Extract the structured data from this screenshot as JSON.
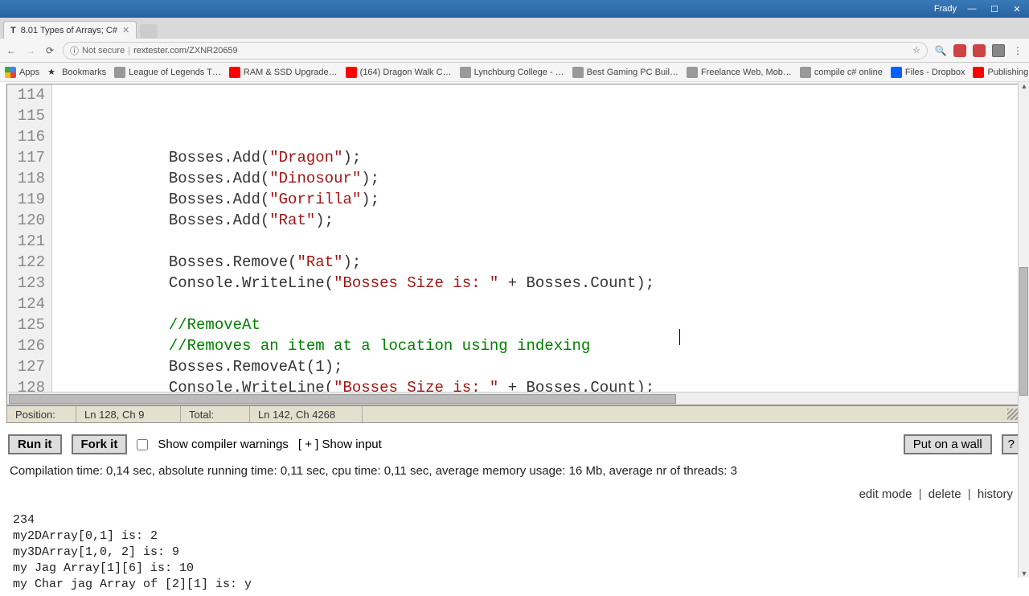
{
  "titlebar": {
    "username": "Frady",
    "min": "—",
    "max": "☐",
    "close": "✕"
  },
  "tab": {
    "favicon": "T",
    "title": "8.01 Types of Arrays; C#",
    "close": "✕"
  },
  "addr": {
    "back": "←",
    "fwd": "→",
    "reload": "⟳",
    "secure_icon": "ⓘ",
    "secure_text": "Not secure",
    "url": "rextester.com/ZXNR20659",
    "star": "☆",
    "menu": "⋮"
  },
  "bookmarks": [
    {
      "icon": "apps",
      "label": "Apps"
    },
    {
      "icon": "star",
      "label": "Bookmarks"
    },
    {
      "icon": "generic",
      "label": "League of Legends T…"
    },
    {
      "icon": "yt",
      "label": "RAM & SSD Upgrade…"
    },
    {
      "icon": "yt",
      "label": "(164) Dragon Walk C…"
    },
    {
      "icon": "generic",
      "label": "Lynchburg College - …"
    },
    {
      "icon": "generic",
      "label": "Best Gaming PC Buil…"
    },
    {
      "icon": "generic",
      "label": "Freelance Web, Mob…"
    },
    {
      "icon": "generic",
      "label": "compile c# online"
    },
    {
      "icon": "db",
      "label": "Files - Dropbox"
    },
    {
      "icon": "yt",
      "label": "Publishing to Google…"
    }
  ],
  "code": {
    "first_line": 114,
    "lines": [
      {
        "pre": "            Bosses.Add(",
        "str": "\"Dragon\"",
        "post": ");"
      },
      {
        "pre": "            Bosses.Add(",
        "str": "\"Dinosour\"",
        "post": ");"
      },
      {
        "pre": "            Bosses.Add(",
        "str": "\"Gorrilla\"",
        "post": ");"
      },
      {
        "pre": "            Bosses.Add(",
        "str": "\"Rat\"",
        "post": ");"
      },
      {
        "pre": "            ",
        "str": "",
        "post": ""
      },
      {
        "pre": "            Bosses.Remove(",
        "str": "\"Rat\"",
        "post": ");"
      },
      {
        "pre": "            Console.WriteLine(",
        "str": "\"Bosses Size is: \"",
        "post": " + Bosses.Count);"
      },
      {
        "pre": "            ",
        "str": "",
        "post": ""
      },
      {
        "cmt": "            //RemoveAt"
      },
      {
        "cmt": "            //Removes an item at a location using indexing"
      },
      {
        "pre": "            Bosses.RemoveAt(1);",
        "str": "",
        "post": ""
      },
      {
        "pre": "            Console.WriteLine(",
        "str": "\"Bosses Size is: \"",
        "post": " + Bosses.Count);"
      },
      {
        "pre": "            ",
        "str": "",
        "post": ""
      },
      {
        "pre": "            ",
        "str": "",
        "post": ""
      },
      {
        "pre": "",
        "str": "",
        "post": "",
        "hl": true
      }
    ]
  },
  "status": {
    "pos_label": "Position:",
    "pos_value": "Ln 128, Ch 9",
    "total_label": "Total:",
    "total_value": "Ln 142, Ch 4268"
  },
  "buttons": {
    "run": "Run it",
    "fork": "Fork it",
    "warnings": "Show compiler warnings",
    "show_input": "[ + ] Show input",
    "wall": "Put on a wall",
    "help": "?"
  },
  "compilation": "Compilation time: 0,14 sec, absolute running time: 0,11 sec, cpu time: 0,11 sec, average memory usage: 16 Mb, average nr of threads: 3",
  "links": {
    "edit": "edit mode",
    "delete": "delete",
    "history": "history",
    "sep": "|"
  },
  "output_lines": [
    "234",
    "my2DArray[0,1] is: 2",
    "my3DArray[1,0, 2] is: 9",
    "my Jag Array[1][6] is: 10",
    "my Char jag Array of [2][1] is: y"
  ]
}
